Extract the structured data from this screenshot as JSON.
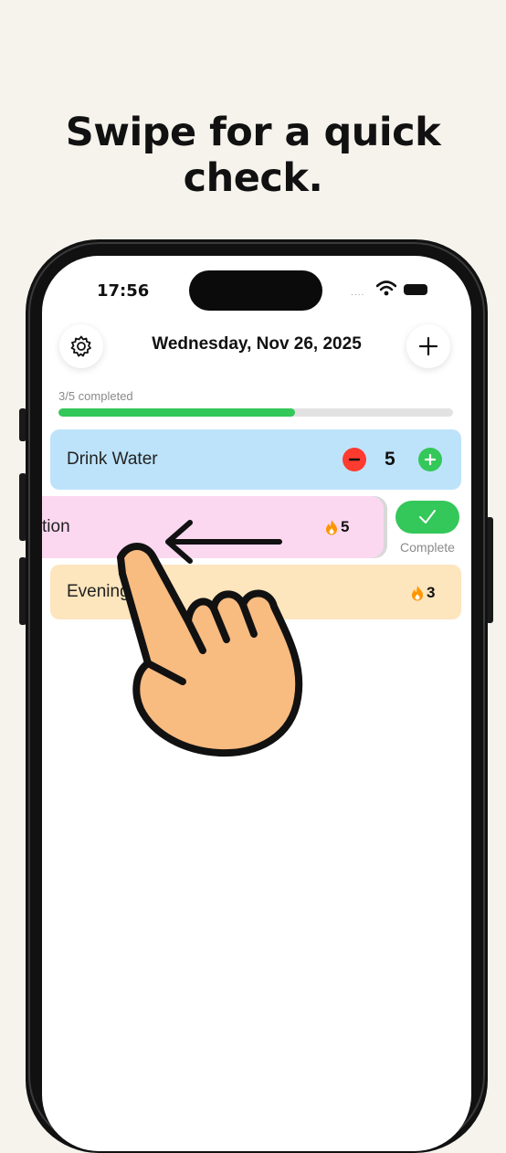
{
  "headline": "Swipe for a quick check.",
  "status_bar": {
    "time": "17:56",
    "signal": "....",
    "wifi_icon": "wifi-icon",
    "battery_icon": "battery-icon"
  },
  "header": {
    "date": "Wednesday, Nov 26, 2025",
    "settings_icon": "gear-icon",
    "add_icon": "plus-icon"
  },
  "progress": {
    "text": "3/5 completed",
    "completed": 3,
    "total": 5
  },
  "habits": [
    {
      "name": "Drink Water",
      "count": "5",
      "color": "#bde3fb"
    },
    {
      "name": "tion",
      "streak": "5",
      "color": "#fbd8f0"
    },
    {
      "name": "Evening",
      "streak": "3",
      "color": "#fde5bd"
    }
  ],
  "swipe_action": {
    "label": "Complete",
    "icon": "checkmark-icon",
    "color": "#34c759"
  },
  "overlay": {
    "hand_icon": "pointing-hand-icon",
    "arrow_icon": "arrow-left-icon"
  },
  "colors": {
    "background": "#f6f3ec",
    "accent_green": "#34c759",
    "accent_red": "#ff3b30",
    "flame": "#ff9500"
  }
}
